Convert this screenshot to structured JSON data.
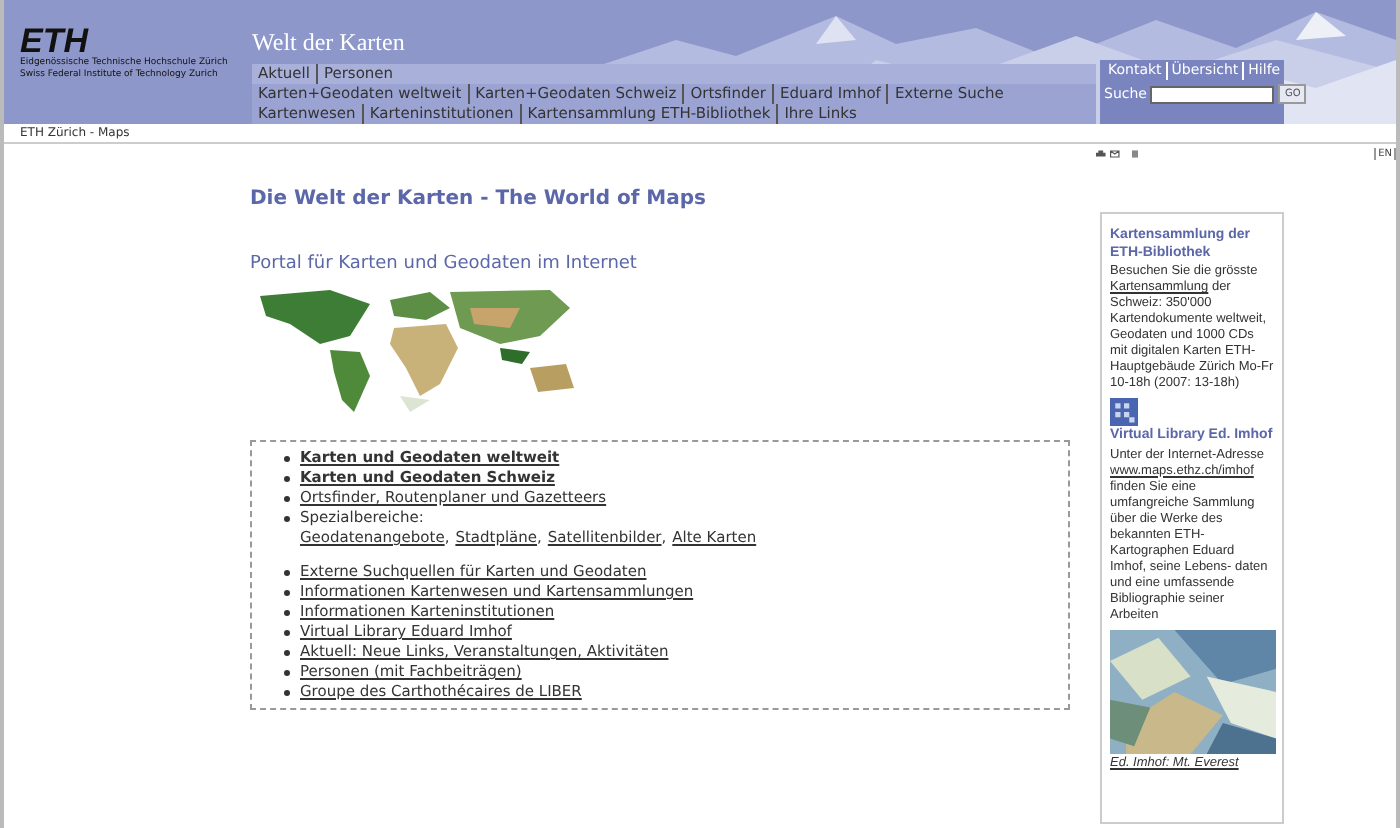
{
  "header": {
    "logo": "ETH",
    "institution_lines": [
      "Eidgenössische Technische Hochschule Zürich",
      "Swiss Federal Institute of Technology Zurich"
    ],
    "site_title": "Welt der Karten",
    "nav_rows": [
      [
        "Aktuell",
        "Personen"
      ],
      [
        "Karten+Geodaten weltweit",
        "Karten+Geodaten Schweiz",
        "Ortsfinder",
        "Eduard Imhof",
        "Externe Suche"
      ],
      [
        "Kartenwesen",
        "Karteninstitutionen",
        "Kartensammlung ETH-Bibliothek",
        "Ihre Links"
      ]
    ],
    "service_links": [
      "Kontakt",
      "Übersicht",
      "Hilfe"
    ],
    "search": {
      "label": "Suche",
      "button": "GO"
    }
  },
  "breadcrumb": "ETH Zürich - Maps",
  "toolbar": {
    "language": "EN"
  },
  "main": {
    "title": "Die Welt der Karten - The World of Maps",
    "subtitle": "Portal für Karten und Geodaten im Internet",
    "list": [
      {
        "kind": "link",
        "text": "Karten und Geodaten weltweit",
        "bold": true
      },
      {
        "kind": "link",
        "text": "Karten und Geodaten Schweiz",
        "bold": true
      },
      {
        "kind": "link",
        "text": "Ortsfinder, Routenplaner und Gazetteers",
        "bold": false
      },
      {
        "kind": "group",
        "text": "Spezialbereiche:",
        "links": [
          "Geodatenangebote",
          "Stadtpläne",
          "Satellitenbilder",
          "Alte Karten"
        ],
        "separator": ","
      },
      {
        "kind": "link",
        "text": "Externe Suchquellen für Karten und Geodaten",
        "bold": false
      },
      {
        "kind": "link",
        "text": "Informationen Kartenwesen und Kartensammlungen",
        "bold": false
      },
      {
        "kind": "link",
        "text": "Informationen Karteninstitutionen",
        "bold": false
      },
      {
        "kind": "link",
        "text": "Virtual Library Eduard Imhof",
        "bold": false
      },
      {
        "kind": "link",
        "text": "Aktuell: Neue Links, Veranstaltungen, Aktivitäten",
        "bold": false
      },
      {
        "kind": "link",
        "text": "Personen (mit Fachbeiträgen)",
        "bold": false
      },
      {
        "kind": "link",
        "text": "Groupe des Carthothécaires de LIBER",
        "bold": false
      }
    ]
  },
  "sidebar": [
    {
      "title": "Kartensammlung der ETH-Bibliothek",
      "before": "Besuchen Sie die grösste",
      "link": "Kartensammlung",
      "after": "der Schweiz: 350'000 Kartendokumente weltweit, Geodaten und 1000 CDs mit digitalen Karten ETH-Hauptgebäude Zürich Mo-Fr 10-18h (2007: 13-18h)"
    },
    {
      "title": "Virtual Library Ed. Imhof",
      "before": "Unter der Internet-Adresse",
      "link": "www.maps.ethz.ch/imhof",
      "after": "finden Sie eine umfangreiche Sammlung über die Werke des bekannten ETH-Kartographen Eduard Imhof, seine Lebens- daten und eine umfassende Bibliographie seiner Arbeiten",
      "caption": "Ed. Imhof: Mt. Everest"
    }
  ]
}
